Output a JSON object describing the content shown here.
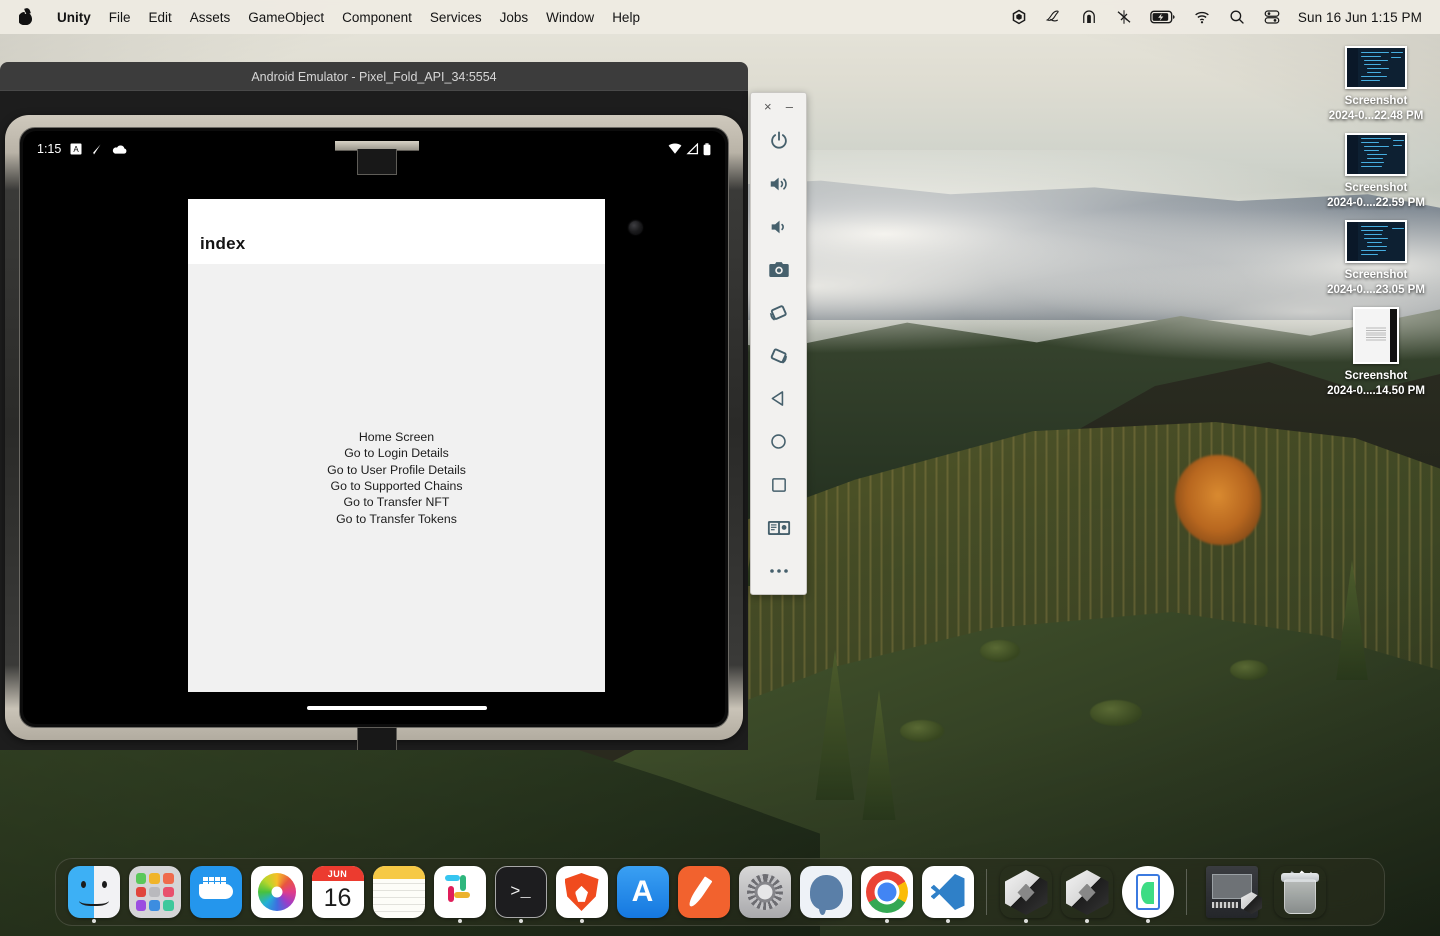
{
  "menubar": {
    "apple_icon": "apple-logo",
    "items": [
      "Unity",
      "File",
      "Edit",
      "Assets",
      "GameObject",
      "Component",
      "Services",
      "Jobs",
      "Window",
      "Help"
    ],
    "status_icons": [
      "unity-icon",
      "script-icon",
      "tunnel-icon",
      "bluetooth-off-icon",
      "battery-charging-icon",
      "wifi-icon",
      "search-icon",
      "control-center-icon"
    ],
    "clock": "Sun 16 Jun 1:15 PM"
  },
  "emulator": {
    "window_title": "Android Emulator - Pixel_Fold_API_34:5554",
    "device": {
      "status_bar": {
        "clock": "1:15",
        "left_icons": [
          "a-badge-icon",
          "pen-slash-icon",
          "cloud-icon"
        ],
        "right_icons": [
          "wifi-icon",
          "signal-icon",
          "battery-icon"
        ]
      },
      "app": {
        "title": "index",
        "links": [
          "Home Screen",
          "Go to Login Details",
          "Go to User Profile Details",
          "Go to Supported Chains",
          "Go to Transfer NFT",
          "Go to Transfer Tokens"
        ]
      }
    },
    "toolbar": {
      "close_label": "×",
      "minimize_label": "–",
      "buttons": [
        "power-icon",
        "volume-up-icon",
        "volume-down-icon",
        "screenshot-camera-icon",
        "rotate-left-icon",
        "rotate-right-icon",
        "back-icon",
        "home-icon",
        "overview-icon",
        "fold-device-icon",
        "more-icon"
      ]
    }
  },
  "desktop": {
    "icons": [
      {
        "name": "Screenshot",
        "date": "2024-0...22.48 PM",
        "type": "code"
      },
      {
        "name": "Screenshot",
        "date": "2024-0....22.59 PM",
        "type": "code"
      },
      {
        "name": "Screenshot",
        "date": "2024-0....23.05 PM",
        "type": "code"
      },
      {
        "name": "Screenshot",
        "date": "2024-0....14.50 PM",
        "type": "doc"
      }
    ]
  },
  "dock": {
    "items": [
      {
        "name": "Finder",
        "icon": "finder-icon",
        "running": true
      },
      {
        "name": "Launchpad",
        "icon": "launchpad-icon",
        "running": false
      },
      {
        "name": "Docker",
        "icon": "docker-icon",
        "running": false
      },
      {
        "name": "Photos",
        "icon": "photos-icon",
        "running": false
      },
      {
        "name": "Calendar",
        "icon": "calendar-icon",
        "running": false,
        "month": "JUN",
        "day": "16"
      },
      {
        "name": "Notes",
        "icon": "notes-icon",
        "running": false
      },
      {
        "name": "Slack",
        "icon": "slack-icon",
        "running": true
      },
      {
        "name": "Terminal",
        "icon": "terminal-icon",
        "running": true,
        "glyph": ">_"
      },
      {
        "name": "Brave",
        "icon": "brave-icon",
        "running": true
      },
      {
        "name": "App Store",
        "icon": "app-store-icon",
        "running": false,
        "glyph": "A"
      },
      {
        "name": "Postman",
        "icon": "postman-icon",
        "running": false
      },
      {
        "name": "System Settings",
        "icon": "system-settings-icon",
        "running": false
      },
      {
        "name": "pgAdmin",
        "icon": "postgresql-icon",
        "running": false
      },
      {
        "name": "Chrome",
        "icon": "chrome-icon",
        "running": true
      },
      {
        "name": "Visual Studio Code",
        "icon": "vscode-icon",
        "running": true
      },
      {
        "name": "Unity Hub",
        "icon": "unity-hub-icon",
        "running": true
      },
      {
        "name": "Unity",
        "icon": "unity-editor-icon",
        "running": true
      },
      {
        "name": "Android Studio",
        "icon": "android-studio-icon",
        "running": true
      }
    ],
    "minimized": [
      {
        "name": "Unity Window",
        "icon": "minimized-unity-window-icon"
      }
    ],
    "trash": {
      "name": "Trash",
      "icon": "trash-icon"
    }
  },
  "colors": {
    "menubar_bg": "#eeebe2",
    "emulator_titlebar": "#3c3c3c",
    "toolbar_bg": "#f2f1ef",
    "toolbar_icon": "#46606c",
    "app_content_bg": "#f1f1f1",
    "app_bar_bg": "#ffffff"
  }
}
